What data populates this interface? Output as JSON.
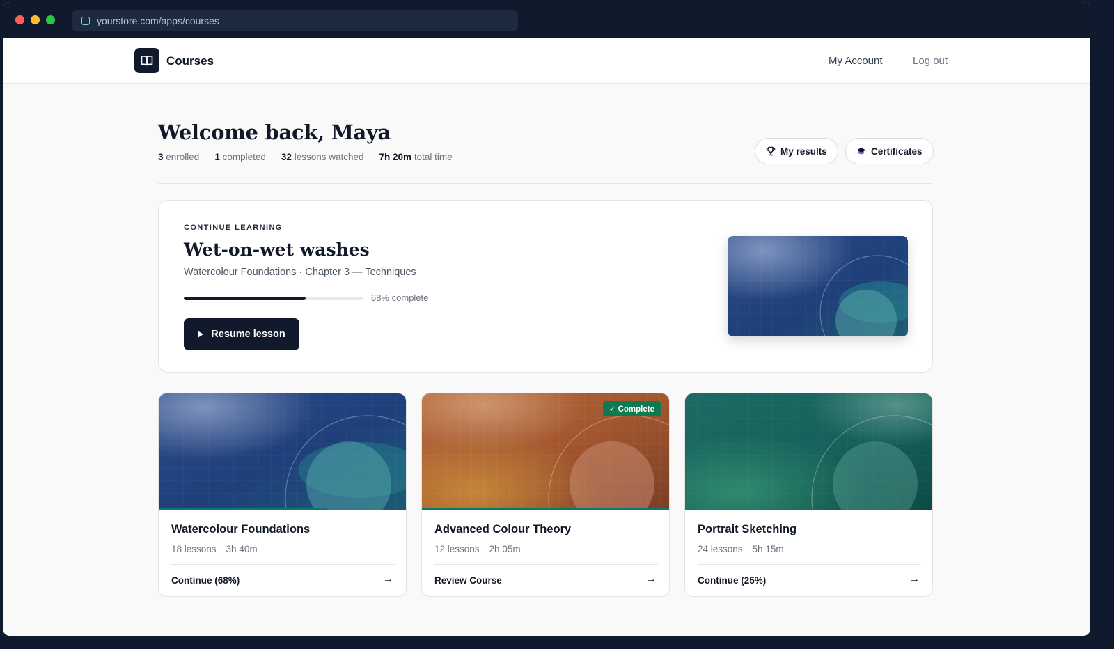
{
  "browser": {
    "url": "yourstore.com/apps/courses"
  },
  "nav": {
    "brand": "Courses",
    "links": [
      {
        "label": "My Account"
      },
      {
        "label": "Log out"
      }
    ]
  },
  "header": {
    "welcome": "Welcome back, Maya",
    "stats": [
      {
        "value": "3",
        "label": "enrolled"
      },
      {
        "value": "1",
        "label": "completed"
      },
      {
        "value": "32",
        "label": "lessons watched"
      },
      {
        "value": "7h 20m",
        "label": "total time"
      }
    ],
    "buttons": [
      {
        "label": "My results",
        "icon": "trophy-icon"
      },
      {
        "label": "Certificates",
        "icon": "graduation-cap-icon"
      }
    ]
  },
  "continue": {
    "eyebrow": "CONTINUE LEARNING",
    "title": "Wet-on-wet washes",
    "subtitle": "Watercolour Foundations · Chapter 3 — Techniques",
    "progress": 0.68,
    "progress_label": "68% complete",
    "button_label": "Resume lesson"
  },
  "courses": [
    {
      "title": "Watercolour Foundations",
      "lessons": "18 lessons",
      "duration": "3h 40m",
      "action": "Continue (68%)",
      "progress": 0.68,
      "badge": "",
      "theme": "blue"
    },
    {
      "title": "Advanced Colour Theory",
      "lessons": "12 lessons",
      "duration": "2h 05m",
      "action": "Review Course",
      "progress": 1.0,
      "badge": "✓ Complete",
      "theme": "orange"
    },
    {
      "title": "Portrait Sketching",
      "lessons": "24 lessons",
      "duration": "5h 15m",
      "action": "Continue (25%)",
      "progress": 0.25,
      "badge": "",
      "theme": "teal"
    }
  ],
  "colors": {
    "navy": "#111a2d",
    "accent_green": "#0f7a52",
    "progress_bar": "#0f766e"
  }
}
